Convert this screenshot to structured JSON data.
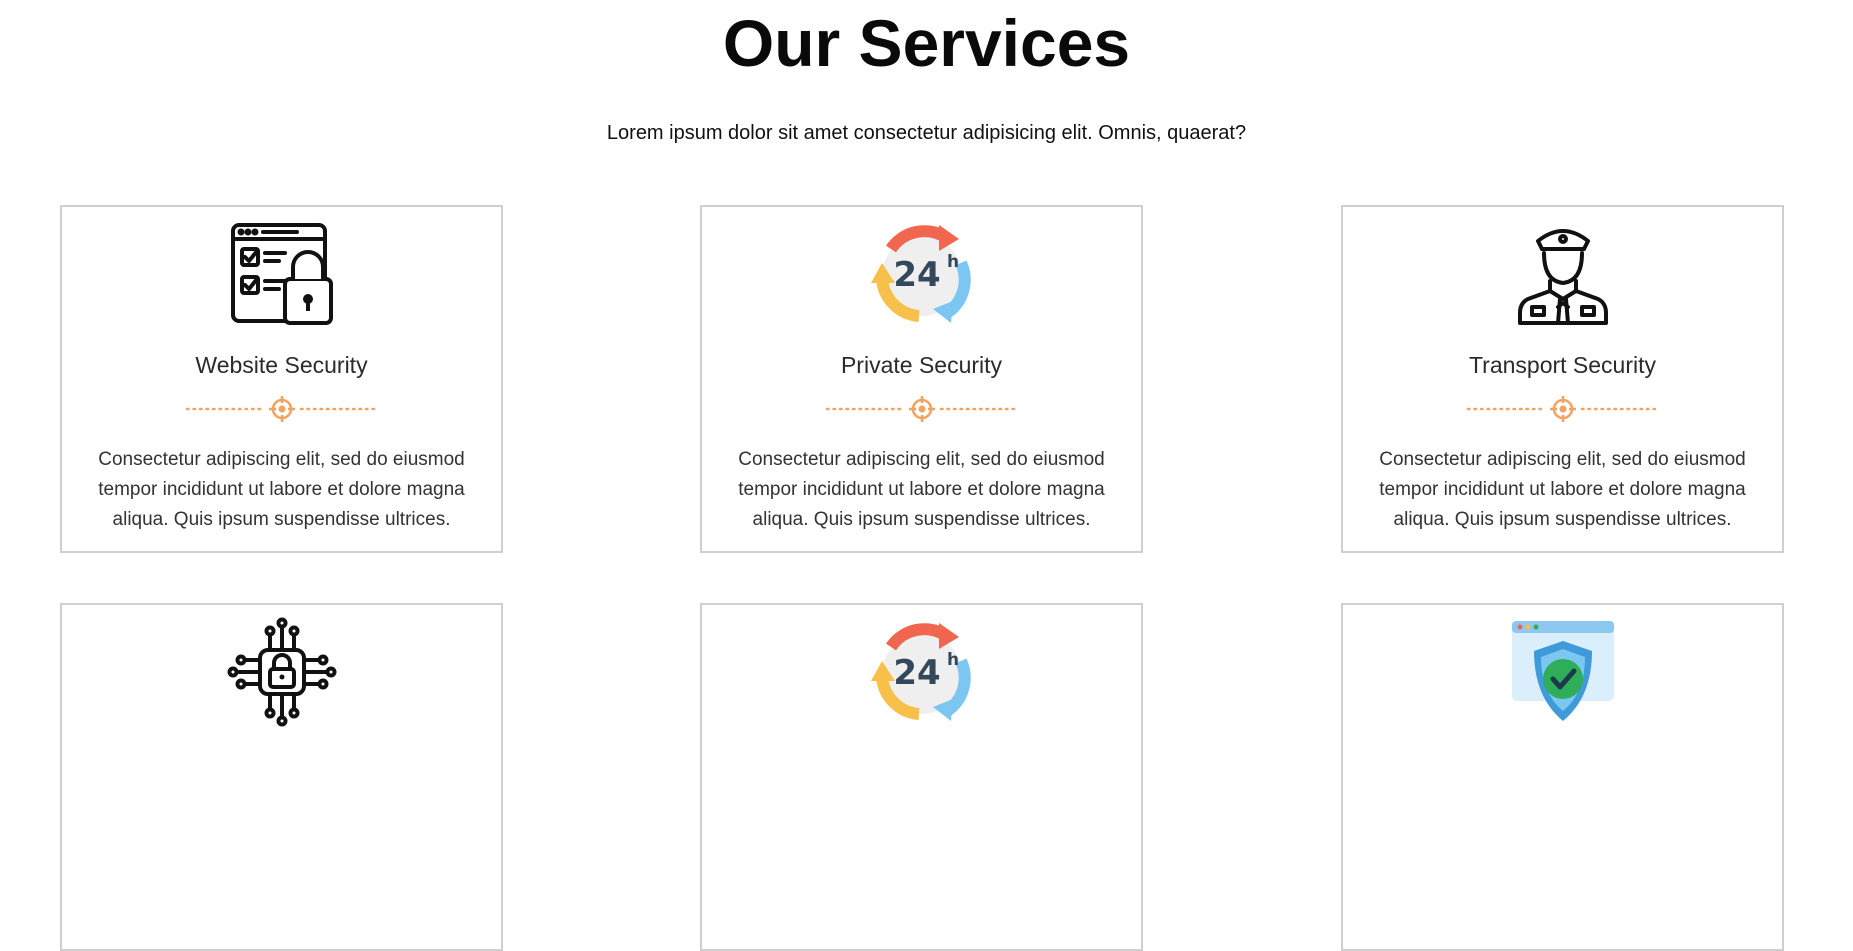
{
  "header": {
    "title": "Our Services",
    "subtitle": "Lorem ipsum dolor sit amet consectetur adipisicing elit. Omnis, quaerat?"
  },
  "colors": {
    "accent": "#f3a35f",
    "border": "#cfcfcf",
    "arrow_red": "#f0664f",
    "arrow_yellow": "#f6c04a",
    "arrow_blue": "#7cc7f2",
    "text_24h": "#33485a",
    "shield_blue": "#3e9ad8",
    "check_green": "#2fae5a"
  },
  "cards": [
    {
      "icon": "website-lock-checklist-icon",
      "title": "Website Security",
      "desc": "Consectetur adipiscing elit, sed do eiusmod tempor incididunt ut labore et dolore magna aliqua. Quis ipsum suspendisse ultrices."
    },
    {
      "icon": "clock-24h-icon",
      "title": "Private Security",
      "desc": "Consectetur adipiscing elit, sed do eiusmod tempor incididunt ut labore et dolore magna aliqua. Quis ipsum suspendisse ultrices."
    },
    {
      "icon": "security-guard-icon",
      "title": "Transport Security",
      "desc": "Consectetur adipiscing elit, sed do eiusmod tempor incididunt ut labore et dolore magna aliqua. Quis ipsum suspendisse ultrices."
    },
    {
      "icon": "chip-lock-icon"
    },
    {
      "icon": "clock-24h-icon"
    },
    {
      "icon": "shield-check-icon"
    }
  ],
  "icon_text": {
    "hours": "24",
    "h": "h"
  }
}
